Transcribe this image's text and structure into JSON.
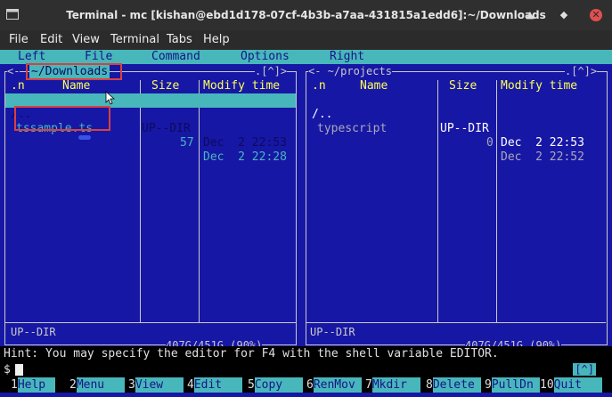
{
  "window": {
    "title": "Terminal - mc [kishan@ebd1d178-07cf-4b3b-a7aa-431815a1edd6]:~/Downloads",
    "minimize_glyph": "▲",
    "maximize_glyph": "◆",
    "close_glyph": "✕"
  },
  "app_menu": [
    "File",
    "Edit",
    "View",
    "Terminal",
    "Tabs",
    "Help"
  ],
  "mc_menu": [
    "Left",
    "File",
    "Command",
    "Options",
    "Right"
  ],
  "left_panel": {
    "left_arrow": "<-",
    "title": "~/Downloads",
    "corner": ".[^]>",
    "headers": {
      "n": ".n",
      "name": "Name",
      "size": "Size",
      "modify": "Modify time"
    },
    "rows": [
      {
        "name": "/..",
        "size": "UP--DIR",
        "time": "Dec  2 22:53"
      },
      {
        "name": "tssample.ts",
        "size": "57",
        "time": "Dec  2 22:28"
      }
    ],
    "mini_status": "UP--DIR",
    "disk": "407G/451G (90%)"
  },
  "right_panel": {
    "title": "<- ~/projects",
    "corner": ".[^]>",
    "headers": {
      "n": ".n",
      "name": "Name",
      "size": "Size",
      "modify": "Modify time"
    },
    "rows": [
      {
        "name": "/..",
        "size": "UP--DIR",
        "time": "Dec  2 22:53"
      },
      {
        "name": "typescript",
        "size": "0",
        "time": "Dec  2 22:52"
      }
    ],
    "mini_status": "UP--DIR",
    "disk": "407G/451G (90%)"
  },
  "hint": "Hint: You may specify the editor for F4 with the shell variable EDITOR.",
  "prompt": {
    "symbol": "$",
    "history_btn": "[^]"
  },
  "fkeys": [
    {
      "num": "1",
      "label": "Help"
    },
    {
      "num": "2",
      "label": "Menu"
    },
    {
      "num": "3",
      "label": "View"
    },
    {
      "num": "4",
      "label": "Edit"
    },
    {
      "num": "5",
      "label": "Copy"
    },
    {
      "num": "6",
      "label": "RenMov"
    },
    {
      "num": "7",
      "label": "Mkdir"
    },
    {
      "num": "8",
      "label": "Delete"
    },
    {
      "num": "9",
      "label": "PullDn"
    },
    {
      "num": "10",
      "label": "Quit"
    }
  ],
  "colors": {
    "panel_bg": "#1717a5",
    "accent_cyan": "#48b7bb",
    "header_yellow": "#ffff57",
    "highlight_red": "#d94040"
  }
}
